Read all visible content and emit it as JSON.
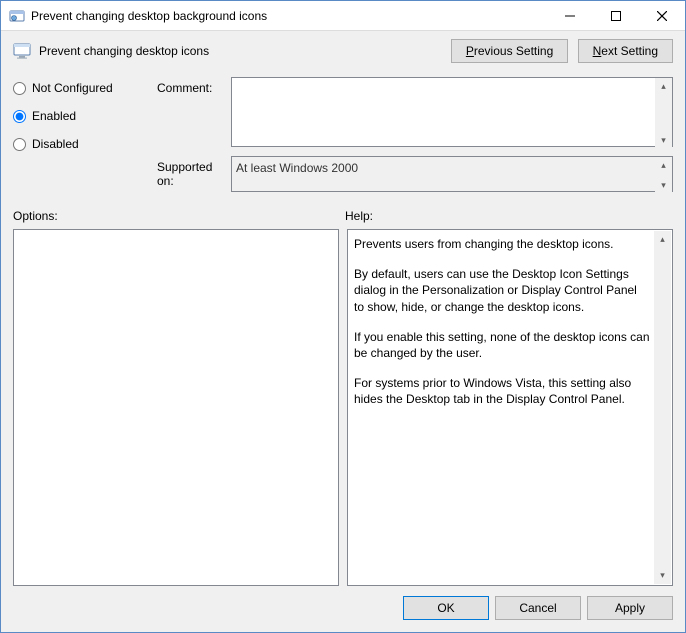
{
  "window": {
    "title": "Prevent changing desktop background icons"
  },
  "header": {
    "setting_title": "Prevent changing desktop icons",
    "prev_p": "P",
    "prev_rest": "revious Setting",
    "next_n": "N",
    "next_rest": "ext Setting"
  },
  "radios": {
    "not_configured": "Not Configured",
    "enabled": "Enabled",
    "disabled": "Disabled",
    "selected": "enabled"
  },
  "labels": {
    "comment": "Comment:",
    "supported_on": "Supported on:",
    "options": "Options:",
    "help": "Help:"
  },
  "comment_value": "",
  "supported_on_value": "At least Windows 2000",
  "help": {
    "p1": "Prevents users from changing the desktop icons.",
    "p2": "By default, users can use the Desktop Icon Settings dialog in the Personalization or Display Control Panel to show, hide, or change the desktop icons.",
    "p3": "If you enable this setting, none of the desktop icons can be changed by the user.",
    "p4": "For systems prior to Windows Vista, this setting also hides the Desktop tab in the Display Control Panel."
  },
  "footer": {
    "ok": "OK",
    "cancel": "Cancel",
    "apply": "Apply"
  }
}
